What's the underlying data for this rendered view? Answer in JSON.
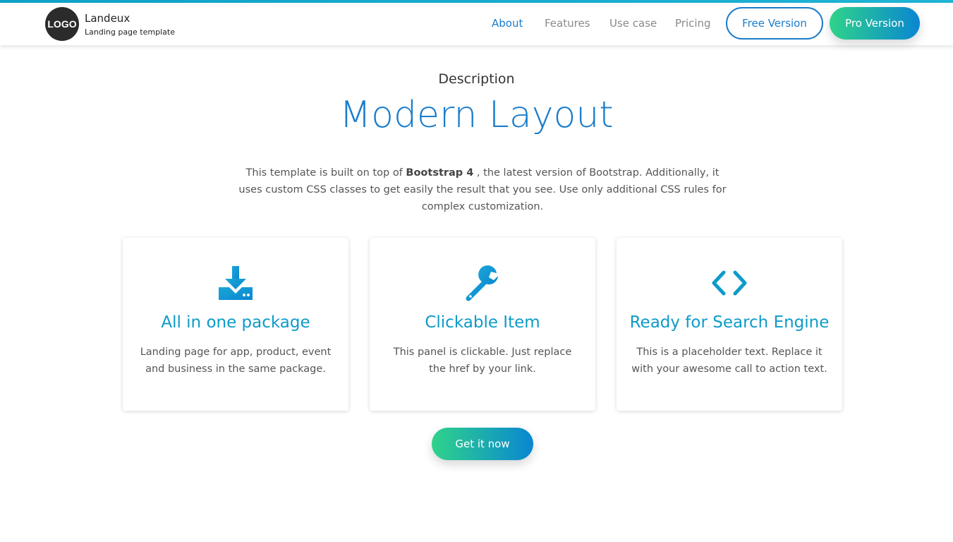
{
  "brand": {
    "logo_text": "LOGO",
    "name": "Landeux",
    "tagline": "Landing page template"
  },
  "nav": {
    "items": [
      {
        "label": "About",
        "active": true
      },
      {
        "label": "Features",
        "active": false
      },
      {
        "label": "Use case",
        "active": false
      },
      {
        "label": "Pricing",
        "active": false
      }
    ],
    "free_button": "Free Version",
    "pro_button": "Pro Version"
  },
  "section": {
    "label": "Description",
    "title": "Modern Layout",
    "intro_before": "This template is built on top of ",
    "intro_bold": "Bootstrap 4",
    "intro_after": " , the latest version of Bootstrap. Additionally, it uses custom CSS classes to get easily the result that you see. Use only additional CSS rules for complex customization."
  },
  "cards": [
    {
      "icon": "download-icon",
      "title": "All in one package",
      "text": "Landing page for app, product, event and business in the same package."
    },
    {
      "icon": "wrench-icon",
      "title": "Clickable Item",
      "text": "This panel is clickable. Just replace the href by your link."
    },
    {
      "icon": "code-icon",
      "title": "Ready for Search Engine",
      "text": "This is a placeholder text. Replace it with your awesome call to action text."
    }
  ],
  "cta_label": "Get it now",
  "colors": {
    "accent_blue": "#1a7dcc",
    "card_title": "#0d9bc9",
    "gradient_start": "#2fd38a",
    "gradient_end": "#0a86d1"
  }
}
